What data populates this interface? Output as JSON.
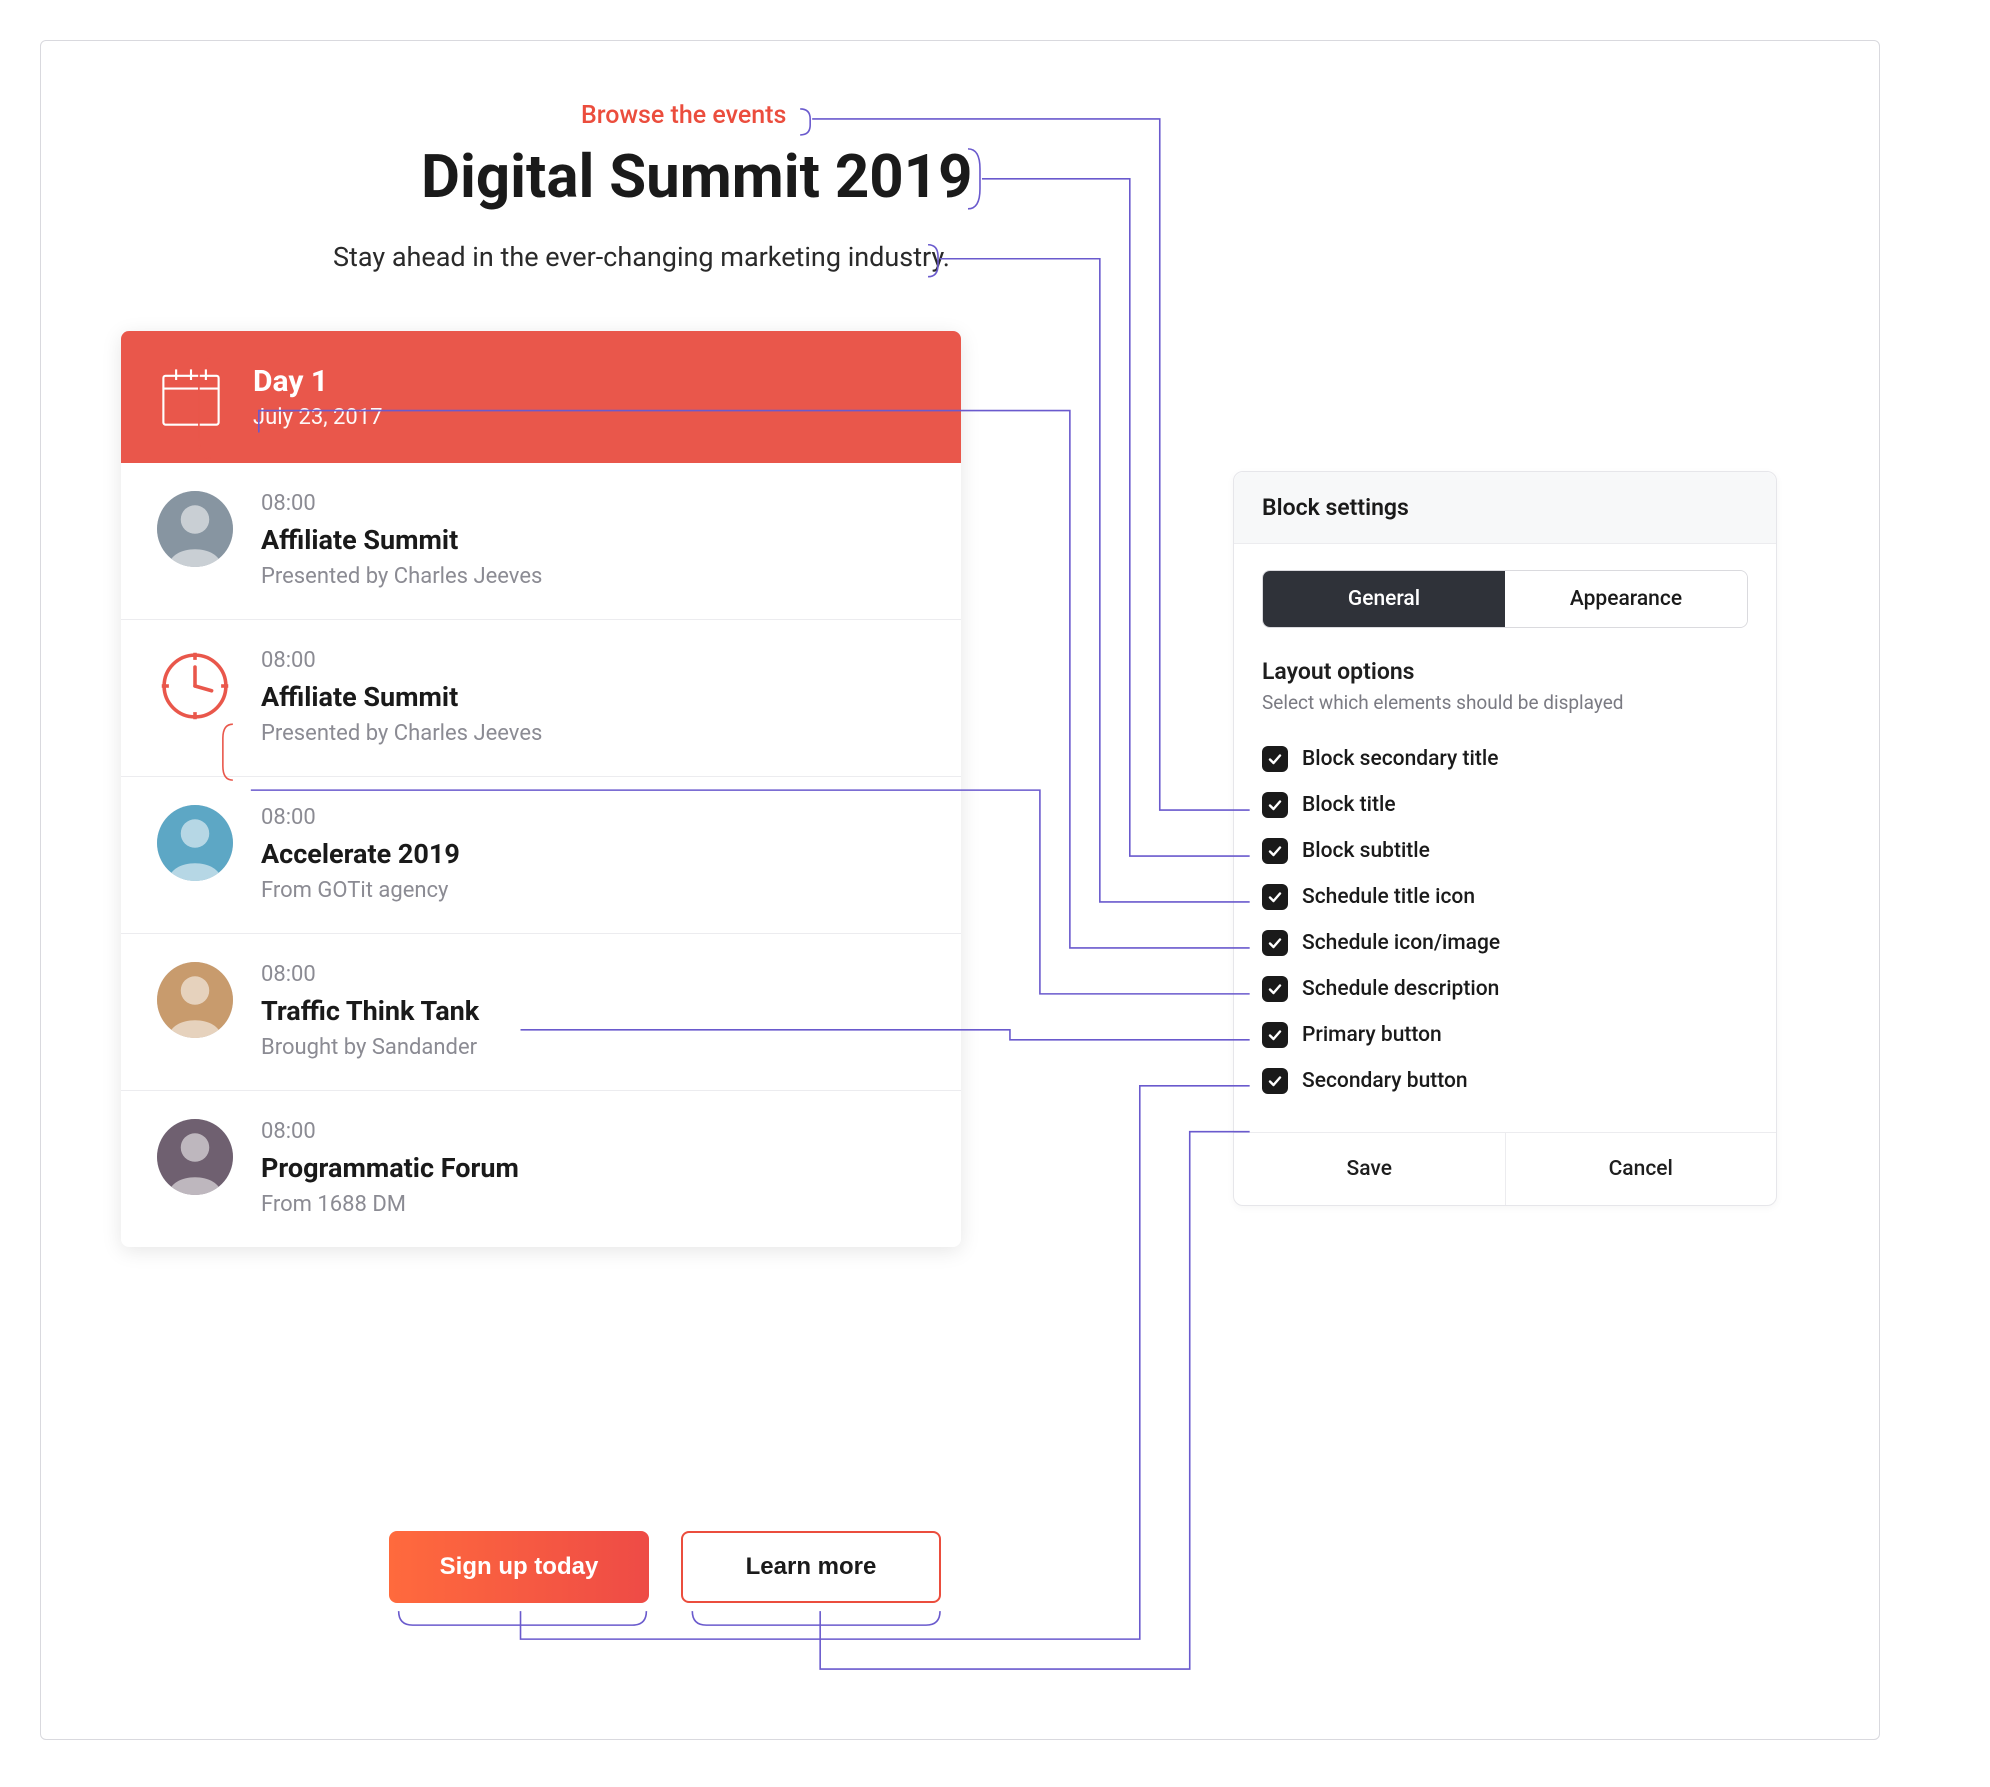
{
  "block": {
    "secondary_title": "Browse the events",
    "title": "Digital Summit 2019",
    "subtitle": "Stay ahead in the ever-changing marketing industry.",
    "primary_button_label": "Sign up today",
    "secondary_button_label": "Learn more"
  },
  "schedule": {
    "day_label": "Day 1",
    "day_date": "July 23, 2017",
    "events": [
      {
        "time": "08:00",
        "title": "Affiliate Summit",
        "desc": "Presented by Charles Jeeves",
        "icon": "avatar"
      },
      {
        "time": "08:00",
        "title": "Affiliate Summit",
        "desc": "Presented by Charles Jeeves",
        "icon": "clock"
      },
      {
        "time": "08:00",
        "title": "Accelerate 2019",
        "desc": "From GOTit agency",
        "icon": "avatar"
      },
      {
        "time": "08:00",
        "title": "Traffic Think Tank",
        "desc": "Brought by Sandander",
        "icon": "avatar"
      },
      {
        "time": "08:00",
        "title": "Programmatic Forum",
        "desc": "From 1688 DM",
        "icon": "avatar"
      }
    ]
  },
  "panel": {
    "heading": "Block settings",
    "tabs": {
      "general": "General",
      "appearance": "Appearance"
    },
    "section_title": "Layout options",
    "section_sub": "Select which elements should be displayed",
    "options": [
      {
        "label": "Block secondary title",
        "checked": true
      },
      {
        "label": "Block title",
        "checked": true
      },
      {
        "label": "Block subtitle",
        "checked": true
      },
      {
        "label": "Schedule title icon",
        "checked": true
      },
      {
        "label": "Schedule icon/image",
        "checked": true
      },
      {
        "label": "Schedule description",
        "checked": true
      },
      {
        "label": "Primary button",
        "checked": true
      },
      {
        "label": "Secondary button",
        "checked": true
      }
    ],
    "save_label": "Save",
    "cancel_label": "Cancel"
  },
  "avatar_colors": [
    "#8795a1",
    "#5da7c5",
    "#c89b6d",
    "#6f6070"
  ]
}
